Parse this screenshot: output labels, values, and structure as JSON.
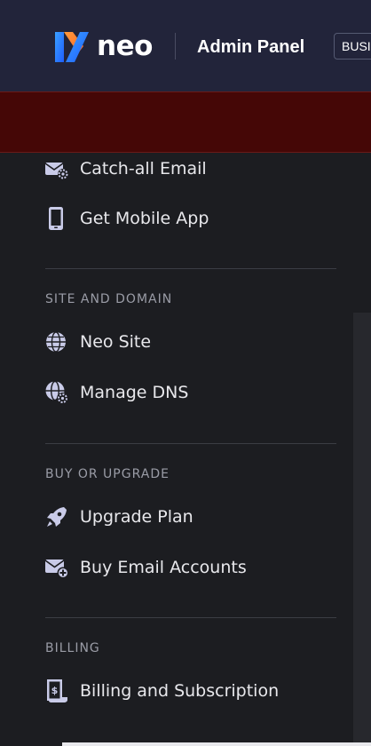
{
  "header": {
    "brand": "neo",
    "title": "Admin Panel",
    "plan_badge": "BUSI"
  },
  "menu": {
    "top_items": [
      {
        "label": "Catch-all Email",
        "icon": "mail-gear-icon"
      },
      {
        "label": "Get Mobile App",
        "icon": "mobile-phone-icon"
      }
    ],
    "sections": [
      {
        "title": "SITE AND DOMAIN",
        "items": [
          {
            "label": "Neo Site",
            "icon": "globe-icon"
          },
          {
            "label": "Manage DNS",
            "icon": "globe-gear-icon"
          }
        ]
      },
      {
        "title": "BUY OR UPGRADE",
        "items": [
          {
            "label": "Upgrade Plan",
            "icon": "rocket-icon"
          },
          {
            "label": "Buy Email Accounts",
            "icon": "mail-plus-icon"
          }
        ]
      },
      {
        "title": "BILLING",
        "items": [
          {
            "label": "Billing and Subscription",
            "icon": "billing-receipt-icon"
          }
        ]
      }
    ]
  },
  "colors": {
    "header_bg": "#22243a",
    "alert_bg": "#450706",
    "sidebar_bg": "#1c1d21",
    "icon_fill": "#c9cbe8",
    "logo_blue": "#2f7bff"
  }
}
